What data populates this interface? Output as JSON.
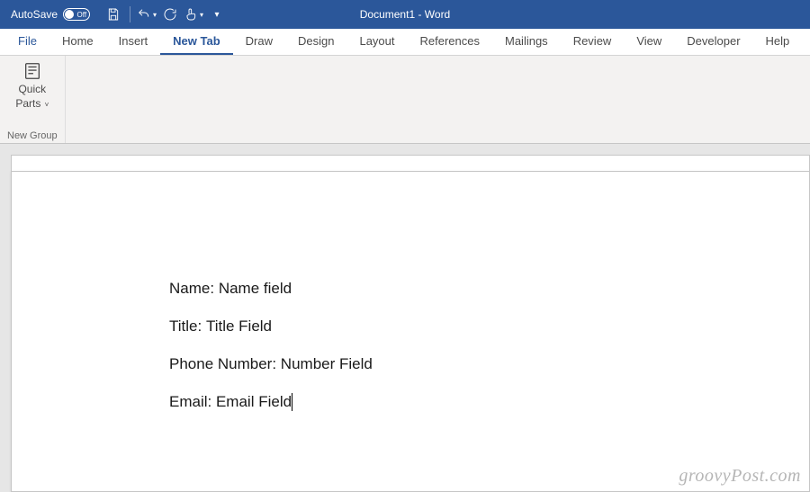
{
  "titlebar": {
    "autosave_label": "AutoSave",
    "autosave_state": "Off",
    "document_title": "Document1  -  Word"
  },
  "ribbon": {
    "tabs": [
      {
        "label": "File"
      },
      {
        "label": "Home"
      },
      {
        "label": "Insert"
      },
      {
        "label": "New Tab"
      },
      {
        "label": "Draw"
      },
      {
        "label": "Design"
      },
      {
        "label": "Layout"
      },
      {
        "label": "References"
      },
      {
        "label": "Mailings"
      },
      {
        "label": "Review"
      },
      {
        "label": "View"
      },
      {
        "label": "Developer"
      },
      {
        "label": "Help"
      }
    ],
    "active_tab_index": 3,
    "group": {
      "button_line1": "Quick",
      "button_line2": "Parts",
      "label": "New Group"
    }
  },
  "document": {
    "lines": [
      {
        "label": "Name",
        "value": "Name field"
      },
      {
        "label": "Title",
        "value": "Title Field"
      },
      {
        "label": "Phone Number",
        "value": "Number Field"
      },
      {
        "label": "Email",
        "value": "Email Field"
      }
    ]
  },
  "watermark": "groovyPost.com"
}
